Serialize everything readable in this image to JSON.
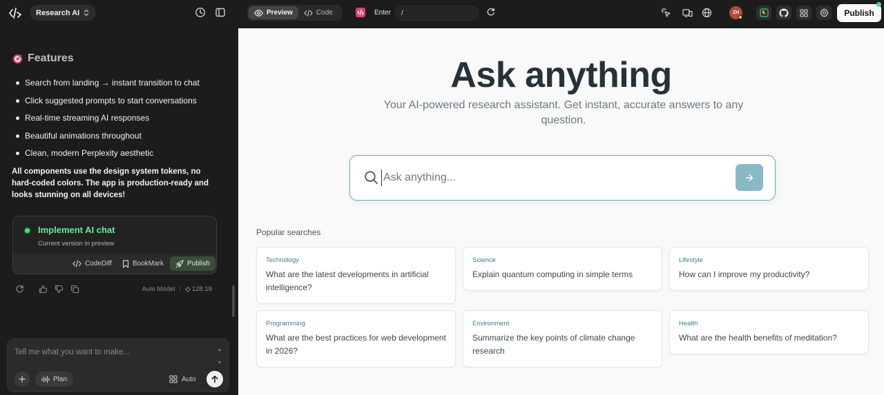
{
  "app": {
    "project_name": "Research AI"
  },
  "chat": {
    "features_title": "Features",
    "features_emoji": "🎯",
    "features": [
      "Search from landing → instant transition to chat",
      "Click suggested prompts to start conversations",
      "Real-time streaming AI responses",
      "Beautiful animations throughout",
      "Clean, modern Perplexity aesthetic"
    ],
    "summary": "All components use the design system tokens, no hard-coded colors. The app is production-ready and looks stunning on all devices!",
    "version_card": {
      "title": "Implement AI chat",
      "subtitle": "Current version in preview",
      "codediff_label": "CodeDiff",
      "bookmark_label": "BookMark",
      "publish_label": "Publish"
    },
    "model_label": "Auto Model",
    "credits": "128.18",
    "composer": {
      "placeholder": "Tell me what you want to make...",
      "plan_label": "Plan",
      "auto_label": "Auto"
    }
  },
  "toolbar": {
    "preview_label": "Preview",
    "code_label": "Code",
    "route_label": "Enter",
    "route_value": "/",
    "avatar_initials": "ZH",
    "publish_label": "Publish"
  },
  "preview": {
    "hero_title": "Ask anything",
    "hero_subtitle": "Your AI-powered research assistant. Get instant, accurate answers to any question.",
    "search_placeholder": "Ask anything...",
    "popular_title": "Popular searches",
    "cards": [
      {
        "category": "Technology",
        "question": "What are the latest developments in artificial intelligence?"
      },
      {
        "category": "Science",
        "question": "Explain quantum computing in simple terms"
      },
      {
        "category": "Lifestyle",
        "question": "How can I improve my productivity?"
      },
      {
        "category": "Programming",
        "question": "What are the best practices for web development in 2026?"
      },
      {
        "category": "Environment",
        "question": "Summarize the key points of climate change research"
      },
      {
        "category": "Health",
        "question": "What are the health benefits of meditation?"
      }
    ]
  },
  "colors": {
    "accent": "#3b7d8c",
    "submit": "#8ab9c6",
    "success": "#4ade80",
    "dark_bg": "#1c1c1c",
    "preview_bg": "#f9f9f9"
  }
}
